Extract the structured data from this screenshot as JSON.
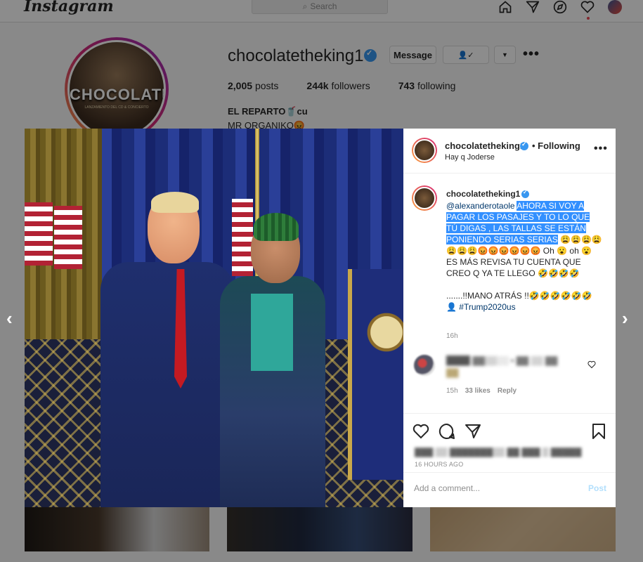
{
  "topbar": {
    "logo": "Instagram",
    "search_placeholder": "Search",
    "icons": [
      "home-icon",
      "direct-icon",
      "explore-icon",
      "activity-heart-icon",
      "profile-avatar"
    ]
  },
  "profile": {
    "username": "chocolatetheking1",
    "pic_text": "CHOCOLATE",
    "pic_sub": "LANZAMIENTO DEL CD & CONCIERTO",
    "buttons": {
      "message": "Message"
    },
    "stats": [
      {
        "value": "2,005",
        "label": "posts"
      },
      {
        "value": "244k",
        "label": "followers"
      },
      {
        "value": "743",
        "label": "following"
      }
    ],
    "bio_name": "EL REPARTO🥤cu",
    "bio_line": "MR ORGANIKO😡"
  },
  "post": {
    "header": {
      "username": "chocolatetheking1",
      "following": "• Following",
      "location": "Hay q Joderse"
    },
    "caption": {
      "username": "chocolatetheking1",
      "mention": "@alexanderotaole",
      "highlighted": "AHORA SI VOY A PAGAR LOS PASAJES Y TO LO QUE TÚ DIGAS , LAS TALLAS SE ESTÁN PONIENDO SERIAS SERIAS",
      "rest1": "😩😩😩😩😩😩😩😡😡😡😡😡😡 Oh 😮 oh 😮 ES MÁS REVISA TU CUENTA QUE CREO Q YA TE LLEGO 🤣🤣🤣🤣",
      "rest2": ".......!!MANO ATRÁS !!🤣🤣🤣🤣🤣🤣👤",
      "hashtag": "#Trump2020us",
      "time": "16h"
    },
    "comment": {
      "meta_time": "15h",
      "meta_likes": "33 likes",
      "meta_reply": "Reply"
    },
    "post_time": "16 HOURS AGO",
    "add_comment_placeholder": "Add a comment...",
    "post_button": "Post"
  }
}
